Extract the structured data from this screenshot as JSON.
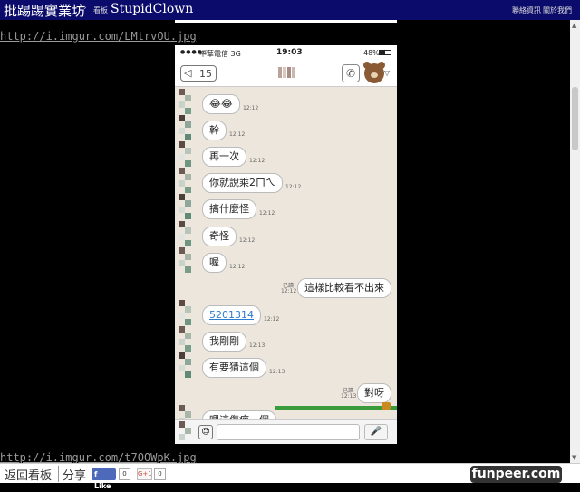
{
  "header": {
    "site_name": "批踢踢實業坊",
    "breadcrumb_sep": "›",
    "board_label": "看板",
    "board_name": "StupidClown",
    "links": [
      "聯絡資訊",
      "關於我們"
    ]
  },
  "content": {
    "image_links": [
      "http://i.imgur.com/LMtrvOU.jpg",
      "http://i.imgur.com/t7OOWpK.jpg"
    ]
  },
  "phone": {
    "status": {
      "signal": "●●●●○",
      "carrier": "中華電信  3G",
      "time": "19:03",
      "battery": "48%"
    },
    "nav": {
      "back_count": "15",
      "back_arrow": "◁"
    },
    "messages": [
      {
        "side": "left",
        "text": "😂😂",
        "time": "12:12"
      },
      {
        "side": "left",
        "text": "幹",
        "time": "12:12"
      },
      {
        "side": "left",
        "text": "再一次",
        "time": "12:12"
      },
      {
        "side": "left",
        "text": "你就說乘2ㄇㄟ",
        "time": "12:12"
      },
      {
        "side": "left",
        "text": "搞什麼怪",
        "time": "12:12"
      },
      {
        "side": "left",
        "text": "奇怪",
        "time": "12:12"
      },
      {
        "side": "left",
        "text": "喔",
        "time": "12:12"
      },
      {
        "side": "right",
        "text": "這樣比較看不出來",
        "time": "12:12",
        "read": "已讀"
      },
      {
        "side": "left",
        "text": "5201314",
        "time": "12:12",
        "link": true
      },
      {
        "side": "left",
        "text": "我剛剛",
        "time": "12:13"
      },
      {
        "side": "left",
        "text": "有要猜這個",
        "time": "12:13"
      },
      {
        "side": "right",
        "text": "對呀",
        "time": "12:13",
        "read": "已讀"
      },
      {
        "side": "left",
        "text": "哩這傷疤一個",
        "time": ""
      }
    ],
    "input": {
      "emoji": "☺",
      "mic": "🎤"
    }
  },
  "footer": {
    "back_board": "返回看板",
    "share": "分享",
    "fb_like": "f Like",
    "fb_count": "0",
    "gplus": "G+1",
    "gplus_count": "0",
    "brand": "funpeer.com"
  },
  "colors": {
    "header_bg": "#0b0b6b",
    "chat_bg": "#ede6dc",
    "link_blue": "#2b7bd0",
    "fb_blue": "#4c69ba"
  }
}
